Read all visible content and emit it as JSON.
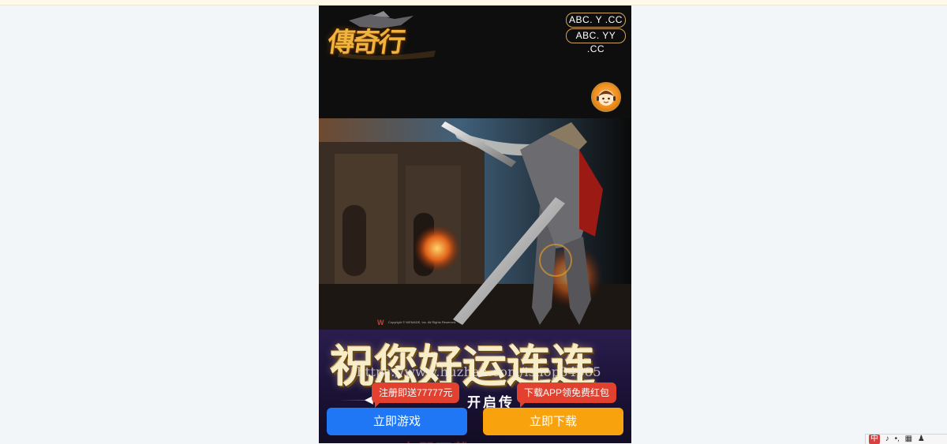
{
  "header": {
    "logo_text": "傳奇行",
    "domains": [
      "ABC. Y .CC",
      "ABC. YY .CC"
    ],
    "support_icon": "customer-service-icon"
  },
  "hero": {
    "logo_mark": "W",
    "copyright": "Copyright © WEMADE, Inc. All Rights Reserved."
  },
  "promo": {
    "slogan": "祝您好运连连",
    "watermark_url": "https://www.huzhan.com/ishop34685",
    "tagline": "开启传",
    "arrow": "◀",
    "background_text": "立即下载"
  },
  "badges": {
    "register": "注册即送77777元",
    "app": "下载APP领免费红包"
  },
  "buttons": {
    "play": "立即游戏",
    "download": "立即下载"
  },
  "tray": {
    "ime": "中",
    "items": [
      "中",
      "♪",
      "•,",
      "▦",
      "♟"
    ]
  },
  "colors": {
    "play_button": "#2077f5",
    "download_button": "#f8a20d",
    "badge": "#e2412f",
    "domain_border": "#cfa55a"
  }
}
